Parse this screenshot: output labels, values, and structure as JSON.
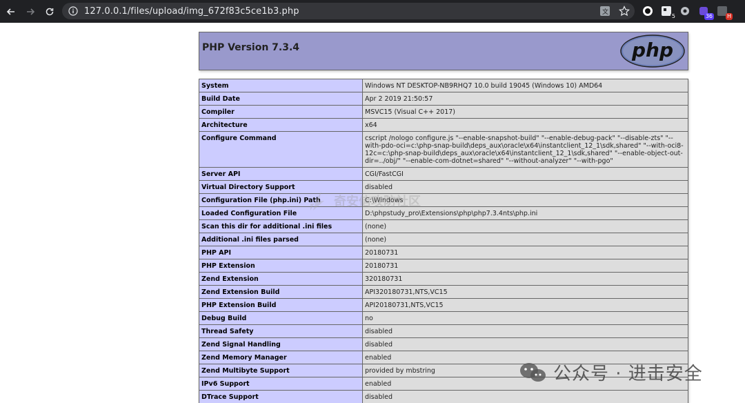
{
  "browser": {
    "url": "127.0.0.1/files/upload/img_672f83c5ce1b3.php",
    "extensions": [
      {
        "icon": "circle-extension-icon"
      },
      {
        "icon": "puzzle-extension-icon",
        "badge": "5"
      },
      {
        "icon": "cog-extension-icon"
      },
      {
        "icon": "purple-extension-icon",
        "badge": "36",
        "badge_color": "#5b3df5"
      },
      {
        "icon": "h-extension-icon",
        "badge": "H",
        "badge_color": "#d93025"
      }
    ]
  },
  "php": {
    "title": "PHP Version 7.3.4",
    "logo_text": "php",
    "rows": [
      {
        "key": "System",
        "value": "Windows NT DESKTOP-NB9RHQ7 10.0 build 19045 (Windows 10) AMD64"
      },
      {
        "key": "Build Date",
        "value": "Apr 2 2019 21:50:57"
      },
      {
        "key": "Compiler",
        "value": "MSVC15 (Visual C++ 2017)"
      },
      {
        "key": "Architecture",
        "value": "x64"
      },
      {
        "key": "Configure Command",
        "value": "cscript /nologo configure.js \"--enable-snapshot-build\" \"--enable-debug-pack\" \"--disable-zts\" \"--with-pdo-oci=c:\\php-snap-build\\deps_aux\\oracle\\x64\\instantclient_12_1\\sdk,shared\" \"--with-oci8-12c=c:\\php-snap-build\\deps_aux\\oracle\\x64\\instantclient_12_1\\sdk,shared\" \"--enable-object-out-dir=../obj/\" \"--enable-com-dotnet=shared\" \"--without-analyzer\" \"--with-pgo\""
      },
      {
        "key": "Server API",
        "value": "CGI/FastCGI"
      },
      {
        "key": "Virtual Directory Support",
        "value": "disabled"
      },
      {
        "key": "Configuration File (php.ini) Path",
        "value": "C:\\Windows"
      },
      {
        "key": "Loaded Configuration File",
        "value": "D:\\phpstudy_pro\\Extensions\\php\\php7.3.4nts\\php.ini"
      },
      {
        "key": "Scan this dir for additional .ini files",
        "value": "(none)"
      },
      {
        "key": "Additional .ini files parsed",
        "value": "(none)"
      },
      {
        "key": "PHP API",
        "value": "20180731"
      },
      {
        "key": "PHP Extension",
        "value": "20180731"
      },
      {
        "key": "Zend Extension",
        "value": "320180731"
      },
      {
        "key": "Zend Extension Build",
        "value": "API320180731,NTS,VC15"
      },
      {
        "key": "PHP Extension Build",
        "value": "API20180731,NTS,VC15"
      },
      {
        "key": "Debug Build",
        "value": "no"
      },
      {
        "key": "Thread Safety",
        "value": "disabled"
      },
      {
        "key": "Zend Signal Handling",
        "value": "disabled"
      },
      {
        "key": "Zend Memory Manager",
        "value": "enabled"
      },
      {
        "key": "Zend Multibyte Support",
        "value": "provided by mbstring"
      },
      {
        "key": "IPv6 Support",
        "value": "enabled"
      },
      {
        "key": "DTrace Support",
        "value": "disabled"
      }
    ]
  },
  "watermarks": {
    "center": "奇安信攻防社区",
    "bottom": "公众号 · 进击安全"
  },
  "colors": {
    "header_bg": "#9999cc",
    "key_bg": "#ccccff",
    "value_bg": "#dddddd"
  }
}
